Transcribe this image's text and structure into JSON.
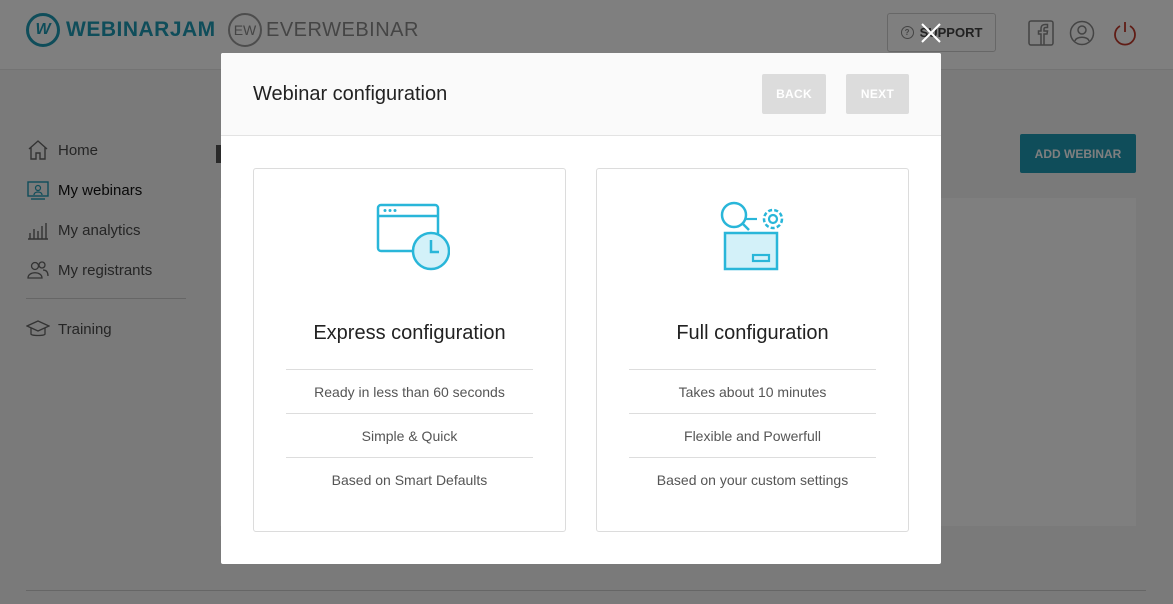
{
  "brand": {
    "webinarjam": "WEBINARJAM",
    "everwebinar": "EVERWEBINAR",
    "webinarjam_mark": "W",
    "everwebinar_mark": "EW"
  },
  "header": {
    "support_label": "SUPPORT"
  },
  "sidebar": {
    "items": [
      {
        "label": "Home",
        "icon": "home-icon"
      },
      {
        "label": "My webinars",
        "icon": "webinars-icon"
      },
      {
        "label": "My analytics",
        "icon": "analytics-icon"
      },
      {
        "label": "My registrants",
        "icon": "registrants-icon"
      },
      {
        "label": "Training",
        "icon": "training-icon"
      }
    ]
  },
  "main": {
    "add_webinar_label": "ADD WEBINAR"
  },
  "modal": {
    "title": "Webinar configuration",
    "back_label": "BACK",
    "next_label": "NEXT",
    "options": [
      {
        "title": "Express configuration",
        "icon": "browser-clock-icon",
        "features": [
          "Ready in less than 60 seconds",
          "Simple & Quick",
          "Based on Smart Defaults"
        ]
      },
      {
        "title": "Full configuration",
        "icon": "search-gear-box-icon",
        "features": [
          "Takes about 10 minutes",
          "Flexible and Powerfull",
          "Based on your custom settings"
        ]
      }
    ]
  },
  "colors": {
    "accent": "#1f9bb5",
    "icon_cyan": "#29b6d9",
    "disabled_button": "#dcdcdc"
  }
}
